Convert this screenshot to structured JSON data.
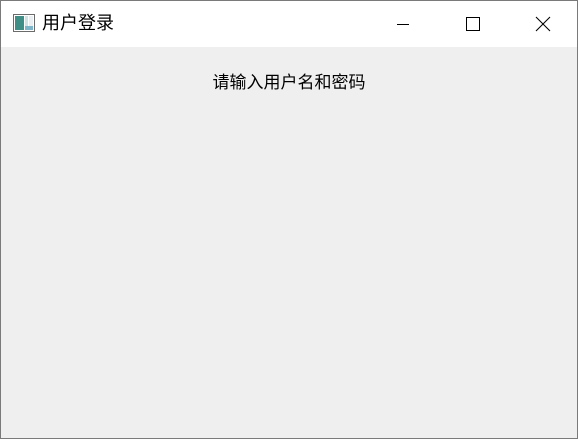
{
  "window": {
    "title": "用户登录",
    "icon": "app-window-icon",
    "controls": {
      "minimize_icon": "minimize-icon",
      "maximize_icon": "maximize-icon",
      "close_icon": "close-icon"
    }
  },
  "content": {
    "prompt": "请输入用户名和密码"
  },
  "colors": {
    "titlebar_bg": "#ffffff",
    "client_bg": "#efefef",
    "text": "#000000"
  }
}
